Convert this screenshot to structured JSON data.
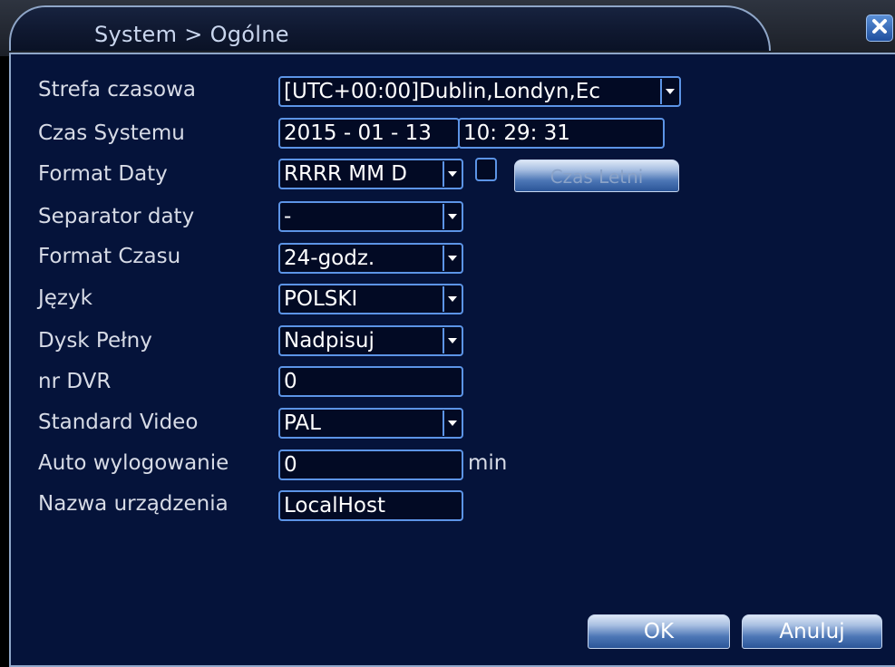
{
  "window": {
    "title": "System > Ogólne"
  },
  "labels": {
    "timezone": "Strefa czasowa",
    "system_time": "Czas Systemu",
    "date_format": "Format Daty",
    "date_separator": "Separator daty",
    "time_format": "Format Czasu",
    "language": "Język",
    "disk_full": "Dysk Pełny",
    "dvr_no": "nr DVR",
    "video_standard": "Standard Video",
    "auto_logout": "Auto wylogowanie",
    "device_name": "Nazwa urządzenia"
  },
  "values": {
    "timezone": "[UTC+00:00]Dublin,Londyn,Ec",
    "date": "2015 - 01 - 13",
    "time": "10: 29: 31",
    "date_format": "RRRR MM D",
    "date_separator": "-",
    "time_format": "24-godz.",
    "language": "POLSKI",
    "disk_full": "Nadpisuj",
    "dvr_no": "0",
    "video_standard": "PAL",
    "auto_logout": "0",
    "device_name": "LocalHost"
  },
  "units": {
    "auto_logout": "min"
  },
  "buttons": {
    "dst": "Czas Letni",
    "ok": "OK",
    "cancel": "Anuluj"
  },
  "dst_checked": false,
  "colors": {
    "panel_bg": "#05133a",
    "field_border": "#5c94e6",
    "text": "#d7dbe6"
  },
  "icons": {
    "close": "close-icon",
    "dropdown": "chevron-down-icon"
  }
}
